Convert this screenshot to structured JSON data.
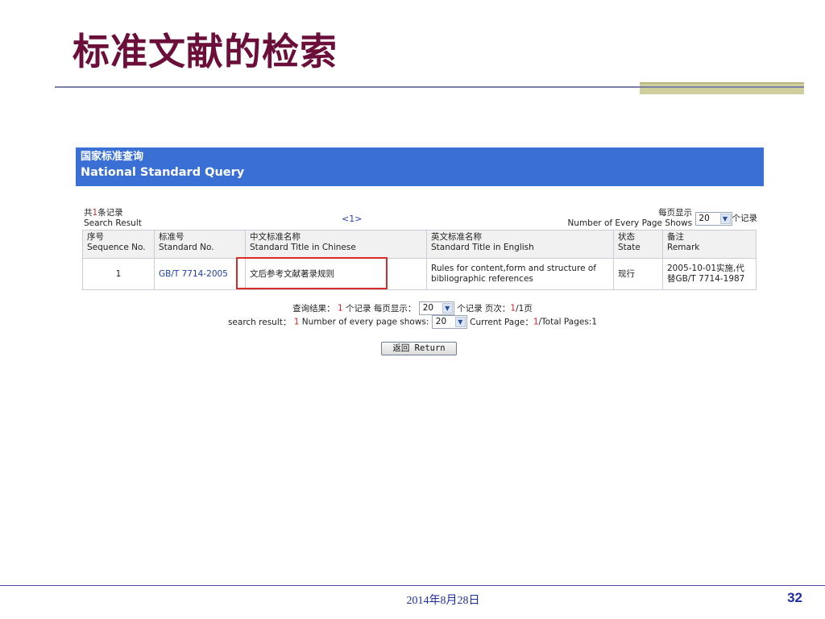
{
  "slide": {
    "title": "标准文献的检索",
    "date": "2014年8月28日",
    "page_number": "32"
  },
  "panel": {
    "title_zh": "国家标准查询",
    "title_en": "National Standard Query"
  },
  "result_bar": {
    "count_prefix": "共",
    "count": "1",
    "count_suffix": "条记录",
    "count_en": "Search Result",
    "pager": "<1>",
    "per_page_zh": "每页显示",
    "per_page_en": "Number of Every Page Shows",
    "per_page_value": "20",
    "per_page_unit": "个记录"
  },
  "table": {
    "headers": [
      {
        "zh": "序号",
        "en": "Sequence No."
      },
      {
        "zh": "标准号",
        "en": "Standard No."
      },
      {
        "zh": "中文标准名称",
        "en": "Standard Title in Chinese"
      },
      {
        "zh": "英文标准名称",
        "en": "Standard Title in English"
      },
      {
        "zh": "状态",
        "en": "State"
      },
      {
        "zh": "备注",
        "en": "Remark"
      }
    ],
    "rows": [
      {
        "seq": "1",
        "standard_no": "GB/T 7714-2005",
        "title_zh": "文后参考文献著录规则",
        "title_en": "Rules for content,form and structure of bibliographic references",
        "state": "现行",
        "remark": "2005-10-01实施,代替GB/T 7714-1987"
      }
    ]
  },
  "footer_pager": {
    "query_result_label": "查询结果：",
    "query_result_count": "1",
    "records_label": "个记录",
    "per_page_label": "每页显示：",
    "per_page_value": "20",
    "records_label2": "个记录",
    "page_label": "页次：",
    "page_current": "1",
    "page_sep": "/1页",
    "search_result_label": "search result：",
    "search_result_count": "1",
    "per_page_en_label": "Number of every page shows:",
    "per_page_en_value": "20",
    "current_page_label": "Current Page：",
    "current_page_value": "1",
    "total_pages": "/Total Pages:1"
  },
  "return_button": "返回 Return",
  "colors": {
    "title": "#6b0f3a",
    "header_bg": "#3a6fd6",
    "highlight": "#d92a2a",
    "link": "#1d3fa8"
  }
}
